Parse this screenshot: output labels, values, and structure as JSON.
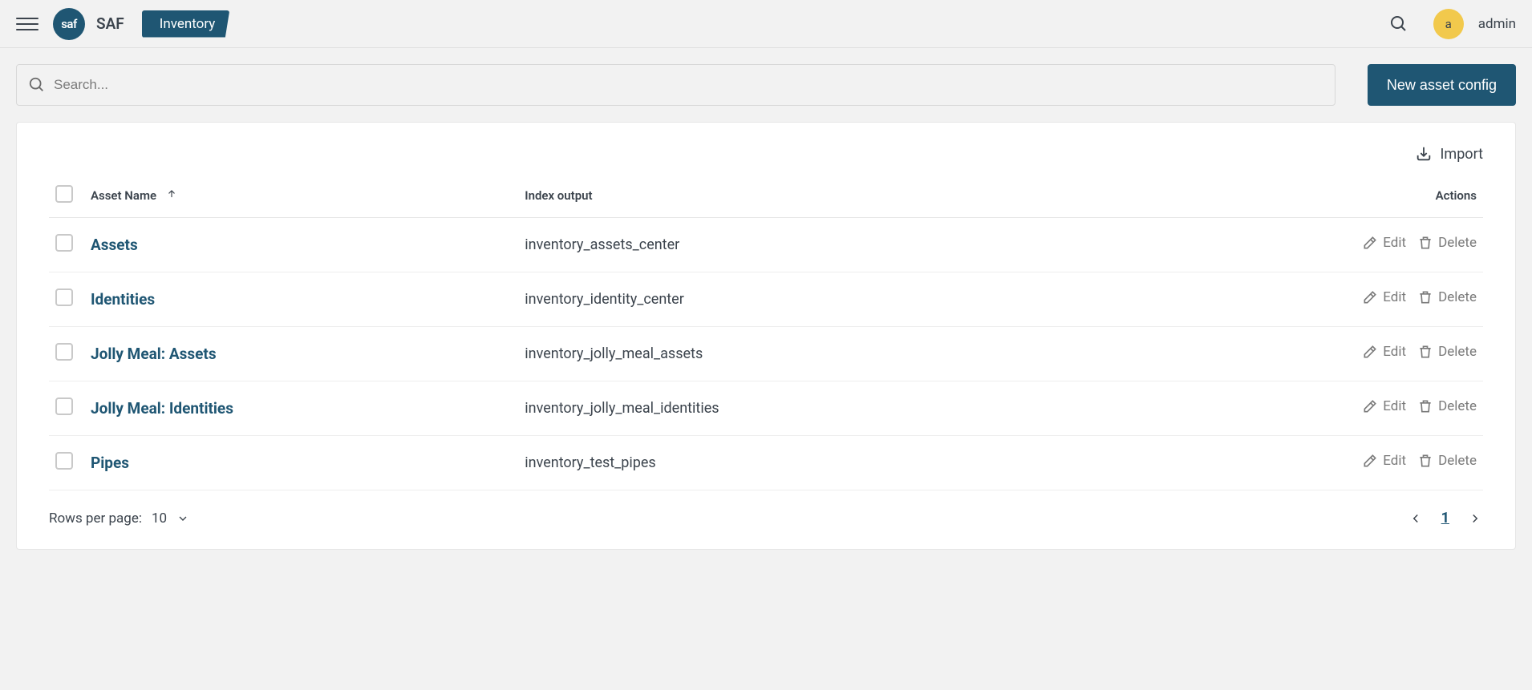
{
  "header": {
    "app_logo_text": "saf",
    "app_name": "SAF",
    "nav_label": "Inventory",
    "avatar_initial": "a",
    "username": "admin"
  },
  "search": {
    "placeholder": "Search..."
  },
  "buttons": {
    "new_asset": "New asset config",
    "import": "Import"
  },
  "table": {
    "columns": {
      "asset_name": "Asset Name",
      "index_output": "Index output",
      "actions": "Actions"
    },
    "action_labels": {
      "edit": "Edit",
      "delete": "Delete"
    },
    "rows": [
      {
        "name": "Assets",
        "index": "inventory_assets_center"
      },
      {
        "name": "Identities",
        "index": "inventory_identity_center"
      },
      {
        "name": "Jolly Meal: Assets",
        "index": "inventory_jolly_meal_assets"
      },
      {
        "name": "Jolly Meal: Identities",
        "index": "inventory_jolly_meal_identities"
      },
      {
        "name": "Pipes",
        "index": "inventory_test_pipes"
      }
    ]
  },
  "footer": {
    "rows_label": "Rows per page:",
    "rows_value": "10",
    "page": "1"
  }
}
